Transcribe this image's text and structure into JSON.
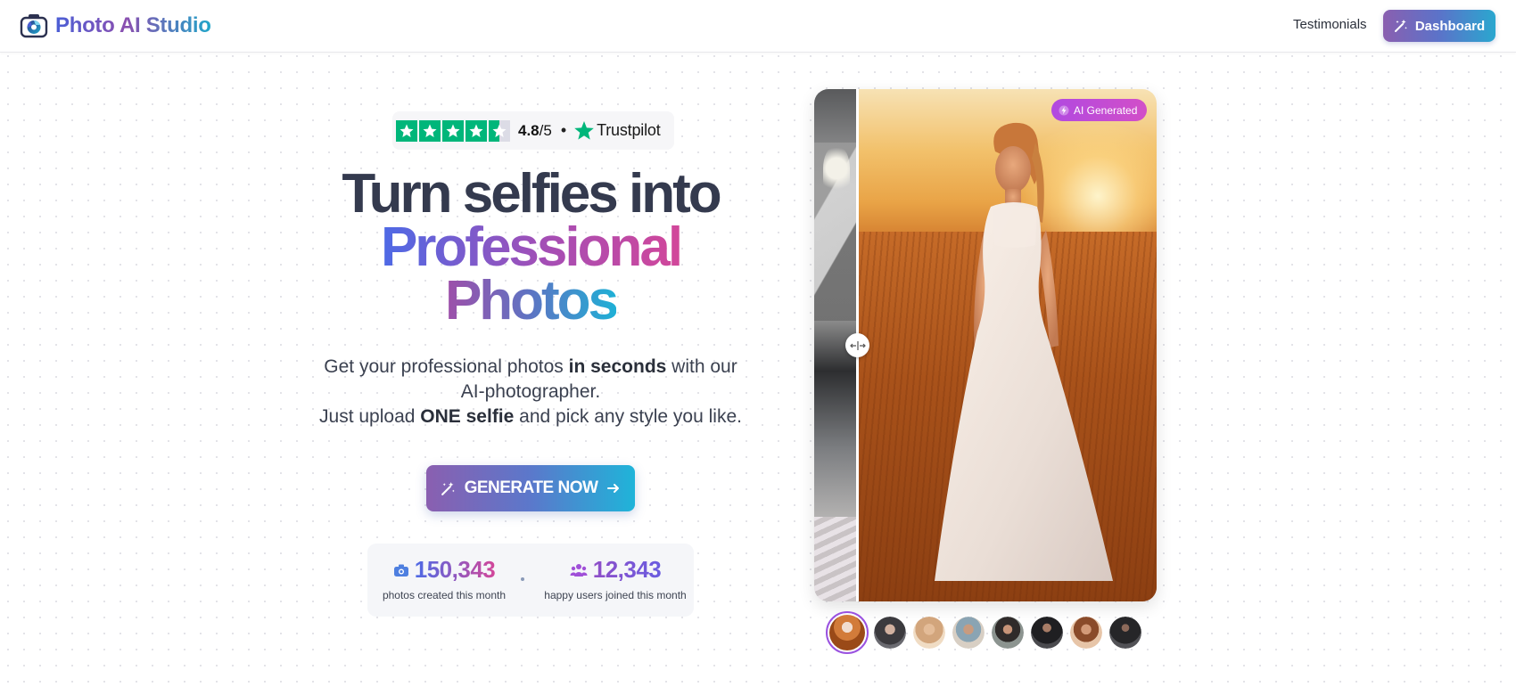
{
  "header": {
    "brand": "Photo AI Studio",
    "nav_testimonials": "Testimonials",
    "dashboard_label": "Dashboard"
  },
  "trustpilot": {
    "score": "4.8",
    "scale": "/5",
    "separator": "•",
    "brand": "Trustpilot",
    "star_count": 5,
    "rating_fraction": 0.96
  },
  "hero": {
    "title_line1": "Turn selfies into",
    "title_line2": "Professional",
    "title_line3": "Photos",
    "sub_part1": "Get your professional photos ",
    "sub_bold1": "in seconds",
    "sub_part2": " with our AI-photographer.",
    "sub_part3": "Just upload ",
    "sub_bold2": "ONE selfie",
    "sub_part4": " and pick any style you like.",
    "cta_label": "GENERATE NOW"
  },
  "stats": {
    "photos_count": "150,343",
    "photos_label": "photos created this month",
    "users_count": "12,343",
    "users_label": "happy users joined this month"
  },
  "showcase": {
    "badge": "AI Generated",
    "thumbnails": [
      "thumb-1",
      "thumb-2",
      "thumb-3",
      "thumb-4",
      "thumb-5",
      "thumb-6",
      "thumb-7",
      "thumb-8"
    ],
    "active_thumbnail": 0
  },
  "colors": {
    "accent_purple": "#8a5fb0",
    "accent_cyan": "#1fb4d9",
    "trustpilot_green": "#00b67a",
    "badge_magenta": "#c04ed8"
  }
}
